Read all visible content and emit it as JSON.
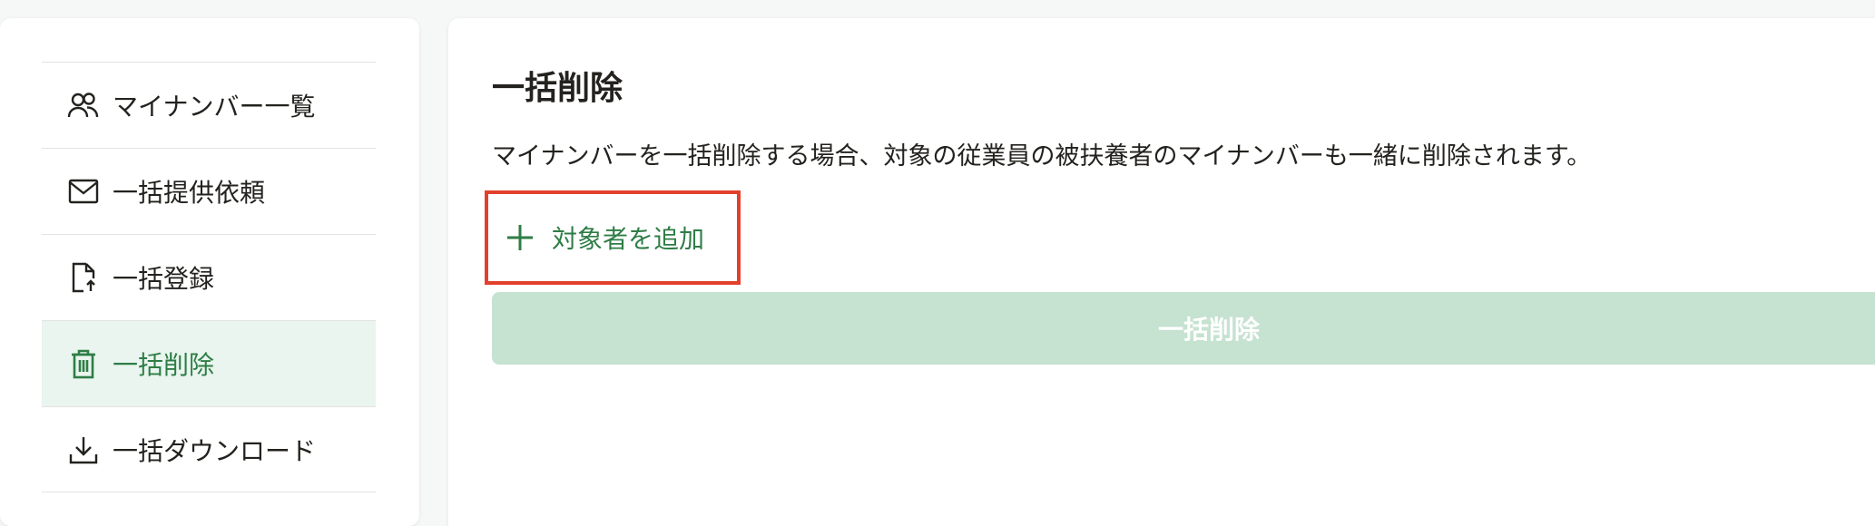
{
  "sidebar": {
    "items": [
      {
        "label": "マイナンバー一覧",
        "icon": "users-icon",
        "active": false
      },
      {
        "label": "一括提供依頼",
        "icon": "mail-icon",
        "active": false
      },
      {
        "label": "一括登録",
        "icon": "file-upload-icon",
        "active": false
      },
      {
        "label": "一括削除",
        "icon": "trash-icon",
        "active": true
      },
      {
        "label": "一括ダウンロード",
        "icon": "download-icon",
        "active": false
      }
    ]
  },
  "main": {
    "title": "一括削除",
    "description": "マイナンバーを一括削除する場合、対象の従業員の被扶養者のマイナンバーも一緒に削除されます。",
    "add_button_label": "対象者を追加",
    "delete_button_label": "一括削除"
  },
  "colors": {
    "accent": "#2e7d46",
    "highlight_border": "#e2402c",
    "disabled_button": "#c6e2d1",
    "active_bg": "#e9f5ee"
  }
}
